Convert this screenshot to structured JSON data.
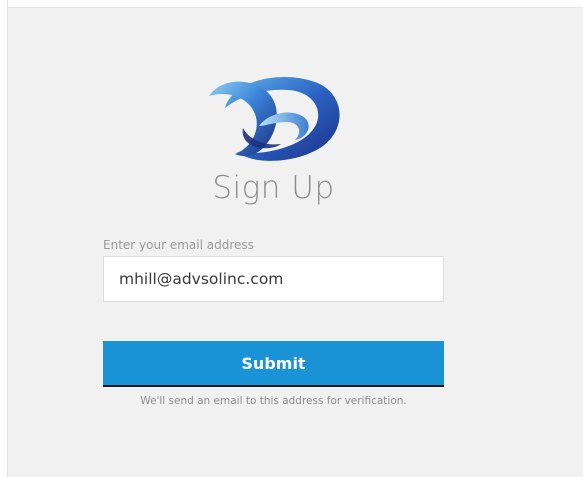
{
  "form": {
    "title": "Sign Up",
    "email_label": "Enter your email address",
    "email_value": "mhill@advsolinc.com",
    "submit_label": "Submit",
    "helper_text": "We'll send an email to this address for verification."
  },
  "colors": {
    "background": "#f1f1f1",
    "button": "#1a93d6",
    "logo_primary": "#2b58b8",
    "logo_accent": "#5fb6e6"
  },
  "logo": {
    "icon": "swirl-logo-icon"
  }
}
